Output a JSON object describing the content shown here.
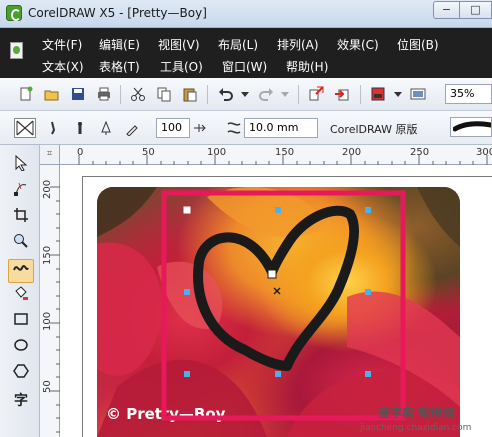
{
  "window": {
    "title": "CorelDRAW X5 - [Pretty—Boy]",
    "minimize_glyph": "−",
    "maximize_glyph": "□"
  },
  "menu": {
    "row1": [
      "文件(F)",
      "编辑(E)",
      "视图(V)",
      "布局(L)",
      "排列(A)",
      "效果(C)",
      "位图(B)"
    ],
    "row2": [
      "文本(X)",
      "表格(T)",
      "工具(O)",
      "窗口(W)",
      "帮助(H)"
    ]
  },
  "toolbar": {
    "icons": [
      "new-icon",
      "open-icon",
      "save-icon",
      "print-icon",
      "cut-icon",
      "copy-icon",
      "paste-icon",
      "undo-icon",
      "redo-icon",
      "import-icon",
      "export-icon",
      "launcher-icon",
      "fullscreen-icon"
    ],
    "zoom": "35%"
  },
  "property_bar": {
    "smoothing": "100",
    "width": "10.0 mm",
    "preset": "CorelDRAW 原版"
  },
  "rulers": {
    "top": [
      "0",
      "50",
      "100",
      "150",
      "200",
      "250",
      "300"
    ],
    "left": [
      "200",
      "150",
      "100",
      "50"
    ]
  },
  "tools": [
    "pick-tool",
    "shape-tool",
    "crop-tool",
    "zoom-tool",
    "freehand-tool",
    "smart-fill-tool",
    "rectangle-tool",
    "ellipse-tool",
    "polygon-tool",
    "text-tool"
  ],
  "text_tool_glyph": "字",
  "canvas": {
    "watermark": "© Pretty—Boy",
    "site_mark": "查字典 教程网",
    "site_url": "jiaocheng.chazidian.com",
    "frame_color": "#e8195a",
    "stroke_color": "#1a1a1a"
  }
}
